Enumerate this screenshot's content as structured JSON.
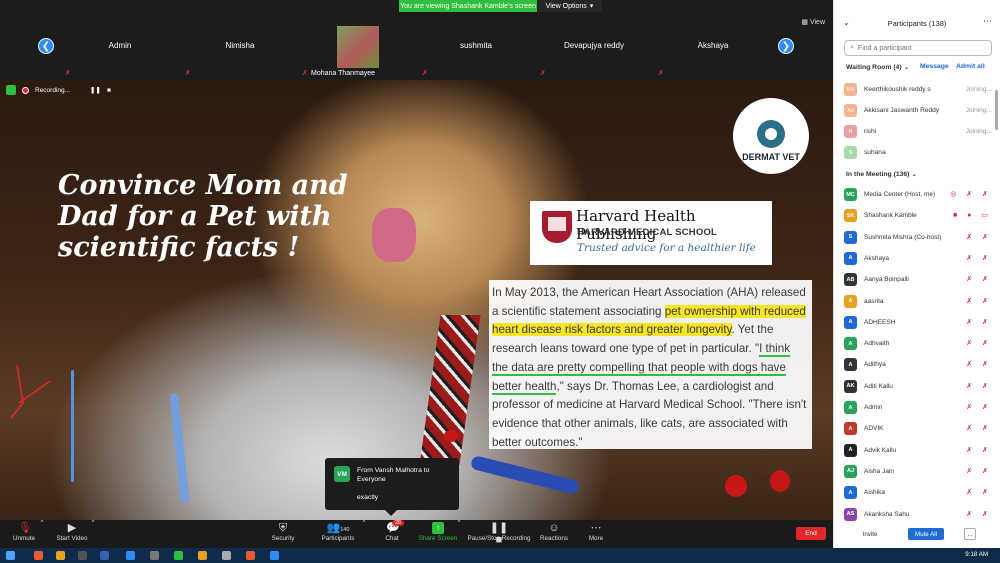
{
  "banner": {
    "message": "You are viewing Shashank Kamble's screen",
    "options": "View Options",
    "options_caret": "▾"
  },
  "view_button": "View",
  "nav": {
    "prev": "❮",
    "next": "❯"
  },
  "tiles": [
    {
      "name": "Admin"
    },
    {
      "name": "Nimisha"
    },
    {
      "name": "Mohana Thanmayee"
    },
    {
      "name": "sushmita"
    },
    {
      "name": "Devapujya reddy"
    },
    {
      "name": "Akshaya"
    }
  ],
  "mic_muted_glyph": "✗",
  "stage": {
    "recording_label": "Recording...",
    "pause_glyph": "❚❚",
    "stop_glyph": "■",
    "headline": "Convince Mom and Dad for a Pet with scientific facts !",
    "logo_text": "DERMAT VET",
    "harvard": {
      "line1": "Harvard Health Publishing",
      "line2": "HARVARD MEDICAL SCHOOL",
      "line3": "Trusted advice for a healthier life"
    },
    "article": {
      "p1": "In May 2013, the American Heart Association (AHA) released a scientific statement associating ",
      "hl": "pet ownership with reduced heart disease risk factors and greater longevity",
      "p2": ". Yet the research leans toward one type of pet in particular. \"",
      "ul": "I think the data are pretty compelling that people with dogs have better health",
      "p3": ",\" says Dr. Thomas Lee, a cardiologist and professor of medicine at Harvard Medical School. \"There isn't evidence that other animals, like cats, are associated with better outcomes.\""
    }
  },
  "chat_toast": {
    "avatar": "VM",
    "from": "From Vansh Malhotra to Everyone",
    "message": "exactly"
  },
  "toolbar": {
    "unmute": "Unmute",
    "start_video": "Start Video",
    "security": "Security",
    "participants": "Participants",
    "participants_count": "140",
    "chat": "Chat",
    "chat_badge": "26",
    "share_screen": "Share Screen",
    "pause_recording": "Pause/Stop Recording",
    "reactions": "Reactions",
    "more": "More",
    "end": "End",
    "caret": "^"
  },
  "panel": {
    "title": "Participants (138)",
    "collapse_glyph": "⌄",
    "menu_glyph": "⋯",
    "search_placeholder": "Find a participant",
    "waiting_title": "Waiting Room (4) ⌄",
    "waiting_message": "Message",
    "waiting_admit": "Admit all",
    "waiting": [
      {
        "name": "Keerthikoushik reddy s",
        "status": "Joining...",
        "avatar": "KR",
        "color": "#f3b48f"
      },
      {
        "name": "Akkisani Jaswanth Reddy",
        "status": "Joining...",
        "avatar": "AJ",
        "color": "#f3b48f"
      },
      {
        "name": "rishi",
        "status": "Joining...",
        "avatar": "R",
        "color": "#e8a0a0"
      },
      {
        "name": "suhana",
        "status": "",
        "avatar": "S",
        "color": "#a8d9a8"
      }
    ],
    "meeting_title": "In the Meeting (136) ⌄",
    "participants": [
      {
        "name": "Media Center (Host, me)",
        "avatar": "MC",
        "color": "#27a65a",
        "icons": "◎ ✗ ✗"
      },
      {
        "name": "Shashank Kamble",
        "avatar": "SK",
        "color": "#e8a020",
        "icons": "■ ● ▭"
      },
      {
        "name": "Sushmita Mishra (Co-host)",
        "avatar": "S",
        "color": "#1f6bd6",
        "icons": "✗ ✗"
      },
      {
        "name": "Akshaya",
        "avatar": "A",
        "color": "#1f6bd6",
        "icons": "✗ ✗"
      },
      {
        "name": "Aanya Boinpalli",
        "avatar": "AB",
        "color": "#333333",
        "icons": "✗ ✗"
      },
      {
        "name": "aasrita",
        "avatar": "A",
        "color": "#e8a020",
        "icons": "✗ ✗"
      },
      {
        "name": "ADHEESH",
        "avatar": "A",
        "color": "#1f6bd6",
        "icons": "✗ ✗"
      },
      {
        "name": "Adhvaith",
        "avatar": "A",
        "color": "#27a65a",
        "icons": "✗ ✗"
      },
      {
        "name": "Adithya",
        "avatar": "A",
        "color": "#333333",
        "icons": "✗ ✗"
      },
      {
        "name": "Aditi Kallu",
        "avatar": "AK",
        "color": "#333333",
        "icons": "✗ ✗"
      },
      {
        "name": "Admin",
        "avatar": "A",
        "color": "#27a65a",
        "icons": "✗ ✗"
      },
      {
        "name": "ADVIK",
        "avatar": "A",
        "color": "#c0392b",
        "icons": "✗ ✗"
      },
      {
        "name": "Advik Kallu",
        "avatar": "A",
        "color": "#222222",
        "icons": "✗ ✗"
      },
      {
        "name": "Aisha Jain",
        "avatar": "AJ",
        "color": "#27a65a",
        "icons": "✗ ✗"
      },
      {
        "name": "Aishika",
        "avatar": "A",
        "color": "#1f6bd6",
        "icons": "✗ ✗"
      },
      {
        "name": "Akanksha Sahu",
        "avatar": "AS",
        "color": "#8e44ad",
        "icons": "✗ ✗"
      }
    ],
    "invite": "Invite",
    "mute_all": "Mute All",
    "more": "..."
  },
  "taskbar": {
    "time": "9:18 AM"
  }
}
